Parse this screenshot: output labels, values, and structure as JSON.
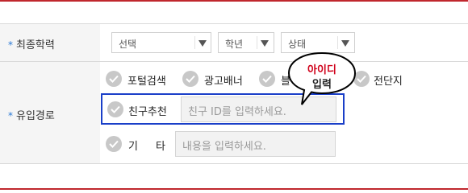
{
  "education": {
    "label": "최종학력",
    "required_mark": "*",
    "selects": [
      {
        "value": "선택"
      },
      {
        "value": "학년"
      },
      {
        "value": "상태"
      }
    ]
  },
  "inflow": {
    "label": "유입경로",
    "required_mark": "*",
    "options": [
      {
        "label": "포털검색"
      },
      {
        "label": "광고배너"
      },
      {
        "label": "블"
      },
      {
        "label": "전단지"
      }
    ],
    "friend": {
      "label": "친구추천",
      "placeholder": "친구 ID를 입력하세요."
    },
    "other": {
      "label_a": "기",
      "label_b": "타",
      "placeholder": "내용을 입력하세요."
    }
  },
  "callout": {
    "line1": "아이디",
    "line2": "입력"
  },
  "colors": {
    "accent_red": "#c0272d",
    "highlight_blue": "#1a3fc8",
    "required_star": "#2a7ad6",
    "callout_red": "#d0021b"
  }
}
